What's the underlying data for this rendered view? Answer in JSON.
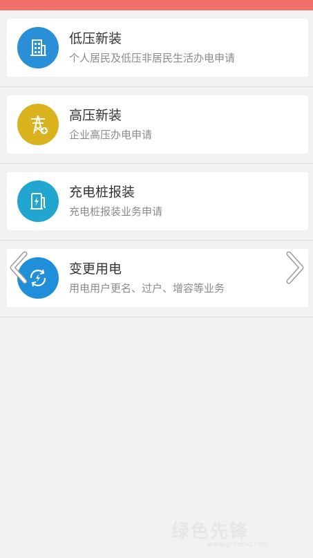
{
  "colors": {
    "topbar": "#f2706b",
    "low_voltage_icon": "#2a8fd6",
    "high_voltage_icon": "#d9b21e",
    "charging_icon": "#21a6cf",
    "change_icon": "#1e8fd8"
  },
  "services": [
    {
      "title": "低压新装",
      "subtitle": "个人居民及低压非居民生活办电申请",
      "icon": "building-icon"
    },
    {
      "title": "高压新装",
      "subtitle": "企业高压办电申请",
      "icon": "power-tower-icon"
    },
    {
      "title": "充电桩报装",
      "subtitle": "充电桩报装业务申请",
      "icon": "charging-pile-icon"
    },
    {
      "title": "变更用电",
      "subtitle": "用电用户更名、过户、增容等业务",
      "icon": "refresh-power-icon"
    }
  ],
  "carousel": {
    "prev_icon": "chevron-left-icon",
    "next_icon": "chevron-right-icon"
  },
  "watermark": {
    "text": "绿色先锋",
    "sub": "www.greenxf.com"
  }
}
